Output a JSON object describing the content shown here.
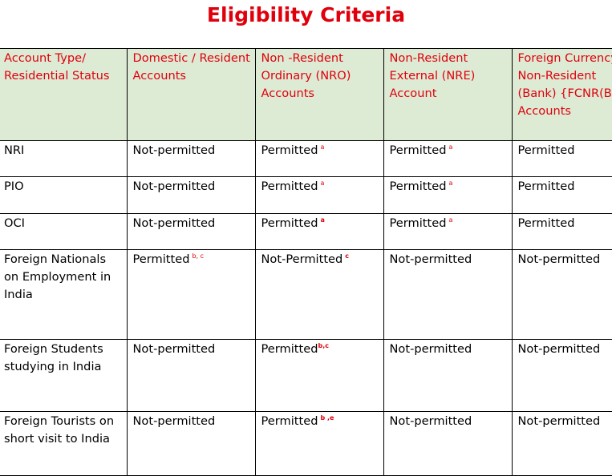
{
  "title": "Eligibility Criteria",
  "headers": {
    "col0": "Account Type/ Residential Status",
    "col1": "Domestic / Resident Accounts",
    "col2": "Non -Resident Ordinary (NRO) Accounts",
    "col3": "Non-Resident External (NRE) Account",
    "col4": "Foreign Currency Non-Resident (Bank) {FCNR(B)} Accounts"
  },
  "rows": [
    {
      "status": "NRI",
      "domestic": "Not-permitted",
      "nro": "Permitted",
      "nro_fn": "a",
      "nre": "Permitted",
      "nre_fn": "a",
      "fcnr": "Permitted"
    },
    {
      "status": "PIO",
      "domestic": "Not-permitted",
      "nro": "Permitted",
      "nro_fn": "a",
      "nre": "Permitted",
      "nre_fn": "a",
      "fcnr": "Permitted"
    },
    {
      "status": "OCI",
      "domestic": "Not-permitted",
      "nro": "Permitted",
      "nro_fn": "a",
      "nre": "Permitted",
      "nre_fn": "a",
      "fcnr": "Permitted"
    },
    {
      "status": "Foreign Nationals on Employment in India",
      "domestic": "Permitted",
      "domestic_fn": "b, c",
      "nro": "Not-Permitted",
      "nro_fn": "c",
      "nre": "Not-permitted",
      "fcnr": "Not-permitted"
    },
    {
      "status": "Foreign Students studying in India",
      "domestic": "Not-permitted",
      "nro": "Permitted",
      "nro_fn": "b,c",
      "nre": "Not-permitted",
      "fcnr": "Not-permitted"
    },
    {
      "status": "Foreign Tourists on short visit to India",
      "domestic": "Not-permitted",
      "nro": "Permitted",
      "nro_fn": "b ,e",
      "nre": "Not-permitted",
      "fcnr": "Not-permitted"
    }
  ],
  "colors": {
    "title": "#e0000c",
    "header_bg": "#ddebd5",
    "header_text": "#e0000c",
    "footnote": "#e0000c"
  }
}
